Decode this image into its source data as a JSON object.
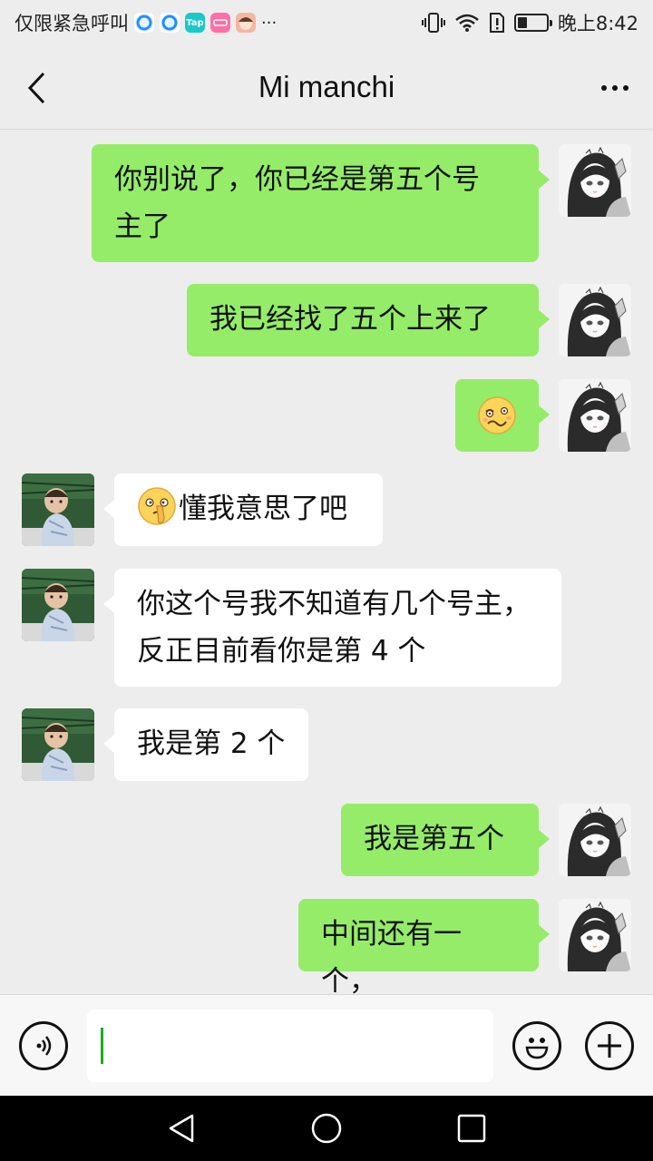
{
  "status_bar": {
    "carrier_text": "仅限紧急呼叫",
    "app_icons": [
      {
        "name": "qq-icon",
        "color": "#1e90ff",
        "label": ""
      },
      {
        "name": "qq-icon",
        "color": "#1e90ff",
        "label": ""
      },
      {
        "name": "taptap-icon",
        "color": "#19c8c8",
        "label": "Tap"
      },
      {
        "name": "app-pink-icon",
        "color": "#ff6fa8",
        "label": ""
      },
      {
        "name": "avatar-app-icon",
        "color": "#f2b8a0",
        "label": ""
      }
    ],
    "more_dots": "···",
    "time": "晚上8:42",
    "battery_level": 0.35
  },
  "header": {
    "title": "Mi manchi"
  },
  "messages": [
    {
      "side": "sent",
      "lines": [
        "你别说了，你已经是第五个号",
        "主了"
      ]
    },
    {
      "side": "sent",
      "lines": [
        "我已经找了五个上来了"
      ]
    },
    {
      "side": "sent",
      "emoji": "woozy-face",
      "lines": []
    },
    {
      "side": "recv",
      "emoji": "shushing-face",
      "lines": [
        "懂我意思了吧"
      ]
    },
    {
      "side": "recv",
      "lines": [
        "你这个号我不知道有几个号主，",
        "反正目前看你是第 4 个"
      ]
    },
    {
      "side": "recv",
      "lines": [
        "我是第 2 个"
      ]
    },
    {
      "side": "sent",
      "lines": [
        "我是第五个"
      ]
    },
    {
      "side": "sent",
      "lines": [
        "中间还有一个，"
      ]
    }
  ],
  "input": {
    "value": "",
    "placeholder": ""
  },
  "colors": {
    "sent_bubble": "#95ec69",
    "recv_bubble": "#ffffff",
    "background": "#ededed",
    "cursor": "#1aad19"
  }
}
